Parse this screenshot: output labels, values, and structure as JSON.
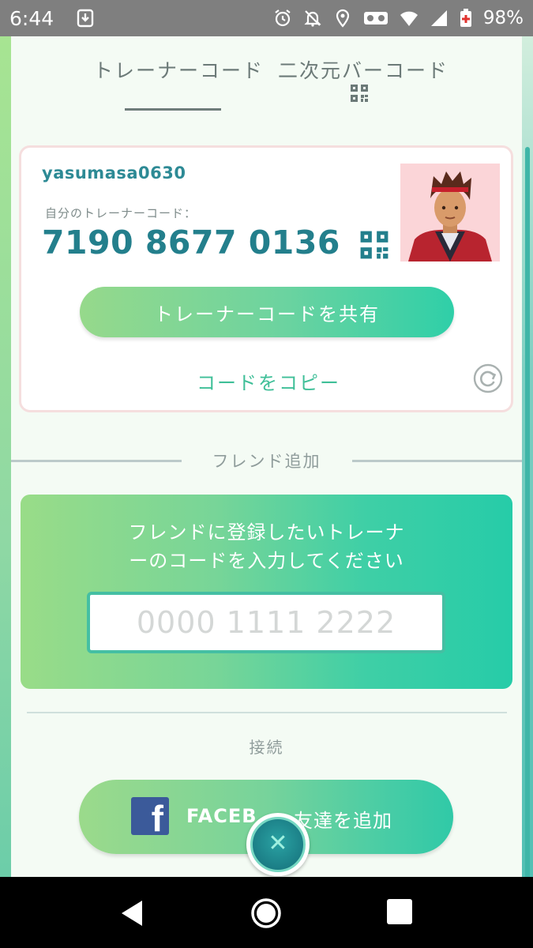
{
  "status_bar": {
    "time": "6:44",
    "battery": "98%",
    "icons": [
      "download-icon",
      "alarm-icon",
      "notifications-off-icon",
      "location-icon",
      "vr-icon",
      "wifi-icon",
      "signal-icon",
      "battery-icon"
    ]
  },
  "tabs": [
    {
      "label": "トレーナーコード",
      "active": true
    },
    {
      "label": "二次元バーコード",
      "active": false
    }
  ],
  "trainer_card": {
    "username": "yasumasa0630",
    "code_label": "自分のトレーナーコード：",
    "code": "7190 8677 0136",
    "share_label": "トレーナーコードを共有",
    "copy_label": "コードをコピー"
  },
  "friend_add": {
    "section_title": "フレンド追加",
    "prompt_line1": "フレンドに登録したいトレーナ",
    "prompt_line2": "ーのコードを入力してください",
    "input_placeholder": "0000 1111 2222"
  },
  "connect": {
    "label": "接続",
    "facebook_text_a": "FACEB",
    "facebook_text_b": "友達を追加"
  },
  "colors": {
    "accent_teal": "#237f8c",
    "button_green": "#6bd3a0",
    "panel_bg": "#f4fbf4"
  }
}
